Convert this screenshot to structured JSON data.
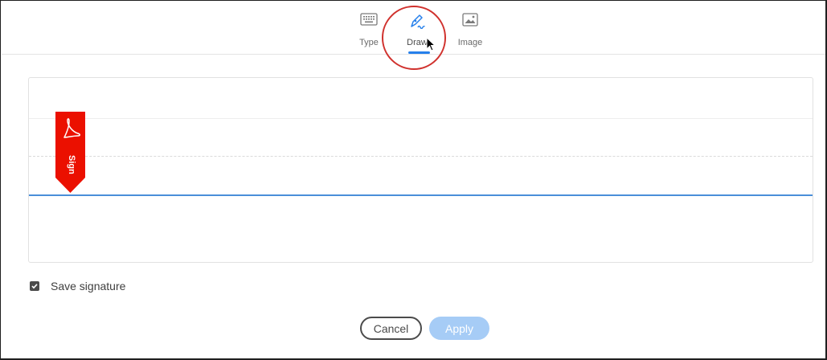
{
  "tabs": [
    {
      "label": "Type",
      "icon": "keyboard-icon"
    },
    {
      "label": "Draw",
      "icon": "pen-icon",
      "active": true
    },
    {
      "label": "Image",
      "icon": "image-icon"
    }
  ],
  "canvas": {
    "sign_flag_label": "Sign",
    "flag_color": "#eb1000"
  },
  "save_signature": {
    "label": "Save signature",
    "checked": true
  },
  "buttons": {
    "cancel": "Cancel",
    "apply": "Apply"
  },
  "colors": {
    "accent": "#2680eb",
    "apply_disabled": "#a6ccf6",
    "annotation_circle": "#d0312d"
  }
}
